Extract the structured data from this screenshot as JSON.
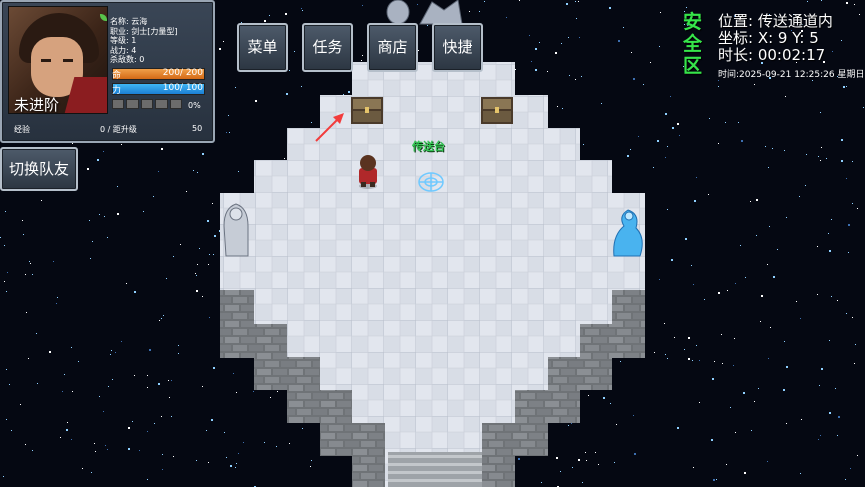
{
  "status": {
    "rank": "未进阶",
    "name": "名称: 云海",
    "job": "职业: 剑士[力量型]",
    "level": "等级: 1",
    "power": "战力: 4",
    "kills": "杀敌数: 0",
    "hp_label": "命",
    "hp_value": "200/ 200",
    "hp_fraction": 1.0,
    "mp_label": "力",
    "mp_value": "100/ 100",
    "mp_fraction": 1.0,
    "xp_percent": "0%",
    "exp_label": "经验",
    "exp_value": "0 / 距升级",
    "exp_next": "50"
  },
  "buttons": {
    "party": "切换队友",
    "menu": "菜单",
    "task": "任务",
    "shop": "商店",
    "quick": "快捷"
  },
  "hud": {
    "safe_zone": "安全区",
    "location": "位置: 传送通道内",
    "coords": "坐标: X: 9  Y: 5",
    "duration": "时长: 00:02:17",
    "clock": "时间:2025-09-21 12:25:26 星期日"
  },
  "map": {
    "teleport_label": "传送台"
  },
  "colors": {
    "safe": "#36e54a",
    "hp": "#e07d23",
    "mp": "#2b98e6",
    "label": "#35c655"
  }
}
